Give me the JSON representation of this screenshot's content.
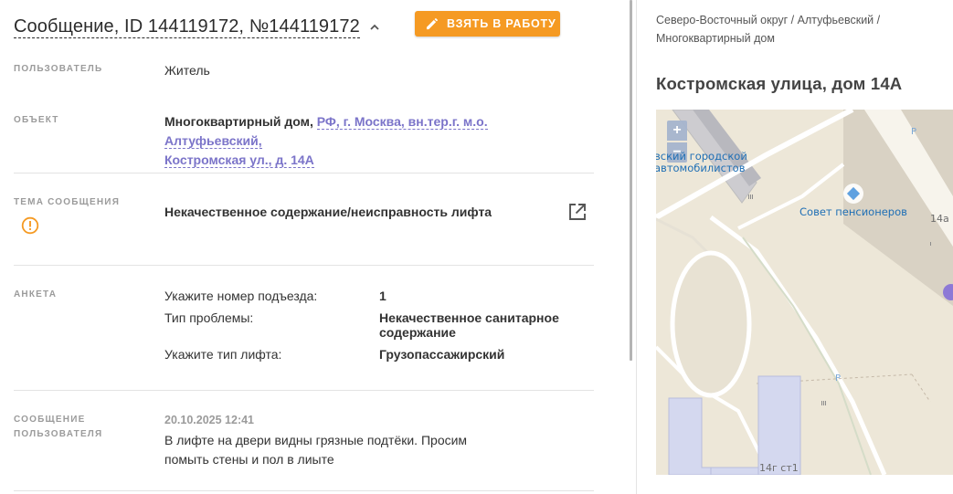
{
  "header": {
    "title": "Сообщение, ID 144119172, №144119172",
    "take_button_label": "ВЗЯТЬ В РАБОТУ"
  },
  "fields": {
    "user": {
      "label": "ПОЛЬЗОВАТЕЛЬ",
      "value": "Житель"
    },
    "object": {
      "label": "ОБЪЕКТ",
      "type": "Многоквартирный дом,",
      "address_line1": "РФ, г. Москва, вн.тер.г. м.о. Алтуфьевский,",
      "address_line2": "Костромская ул., д. 14А"
    },
    "topic": {
      "label": "ТЕМА СООБЩЕНИЯ",
      "value": "Некачественное содержание/неисправность лифта"
    },
    "survey": {
      "label": "АНКЕТА",
      "rows": [
        {
          "q": "Укажите номер подъезда:",
          "a": "1"
        },
        {
          "q": "Тип проблемы:",
          "a": "Некачественное санитарное содержание"
        },
        {
          "q": "Укажите тип лифта:",
          "a": "Грузопассажирский"
        }
      ]
    },
    "message": {
      "label_line1": "СООБЩЕНИЕ",
      "label_line2": "ПОЛЬЗОВАТЕЛЯ",
      "date": "20.10.2025 12:41",
      "text_line1": "В лифте на двери видны грязные подтёки. Просим",
      "text_line2": "помыть стены и пол в лиыте"
    }
  },
  "location": {
    "breadcrumb_line1": "Северо-Восточный округ / Алтуфьевский /",
    "breadcrumb_line2": "Многоквартирный дом",
    "address": "Костромская улица, дом 14А",
    "map": {
      "label_org_line1": "вский городской",
      "label_org_line2": "автомобилистов",
      "label_council": "Совет пенсионеров",
      "house_14a": "14а",
      "house_14g": "14г ст1",
      "parking": "P",
      "zoom_in": "+",
      "zoom_out": "−"
    }
  },
  "colors": {
    "accent": "#f59a23",
    "link": "#7b74c9",
    "warning": "#f59a23",
    "map_label": "#1f6fb5"
  },
  "icons": {
    "header_toggle": "chevron-up-icon",
    "take_button": "pencil-icon",
    "topic_status": "warning-circle-icon",
    "topic_open": "external-link-icon"
  }
}
